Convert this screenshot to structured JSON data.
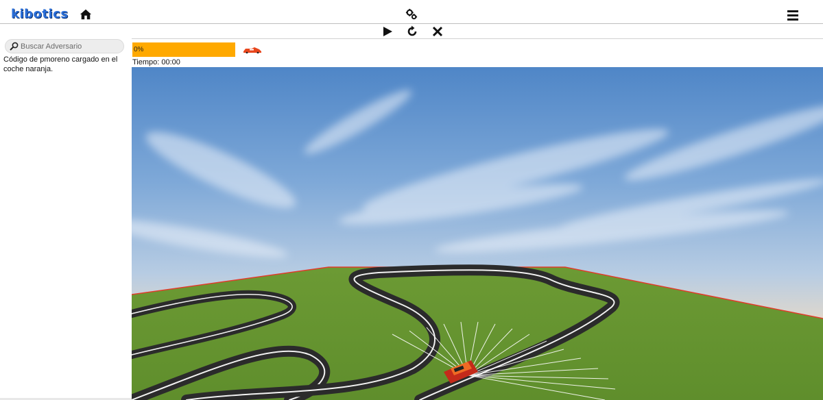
{
  "app": {
    "logo": "kibotics"
  },
  "header": {
    "home_icon": "home-icon",
    "settings_icon": "gears-icon",
    "menu_icon": "hamburger-menu-icon"
  },
  "controls": {
    "play_icon": "play-icon",
    "reset_icon": "reset-icon",
    "stop_icon": "close-icon"
  },
  "sidebar": {
    "search_placeholder": "Buscar Adversario",
    "message": "Código de pmoreno cargado en el coche naranja."
  },
  "simulation": {
    "progress_label": "0%",
    "progress_value": 0,
    "progress_color": "#ffa900",
    "timer": "Tiempo: 00:00"
  }
}
